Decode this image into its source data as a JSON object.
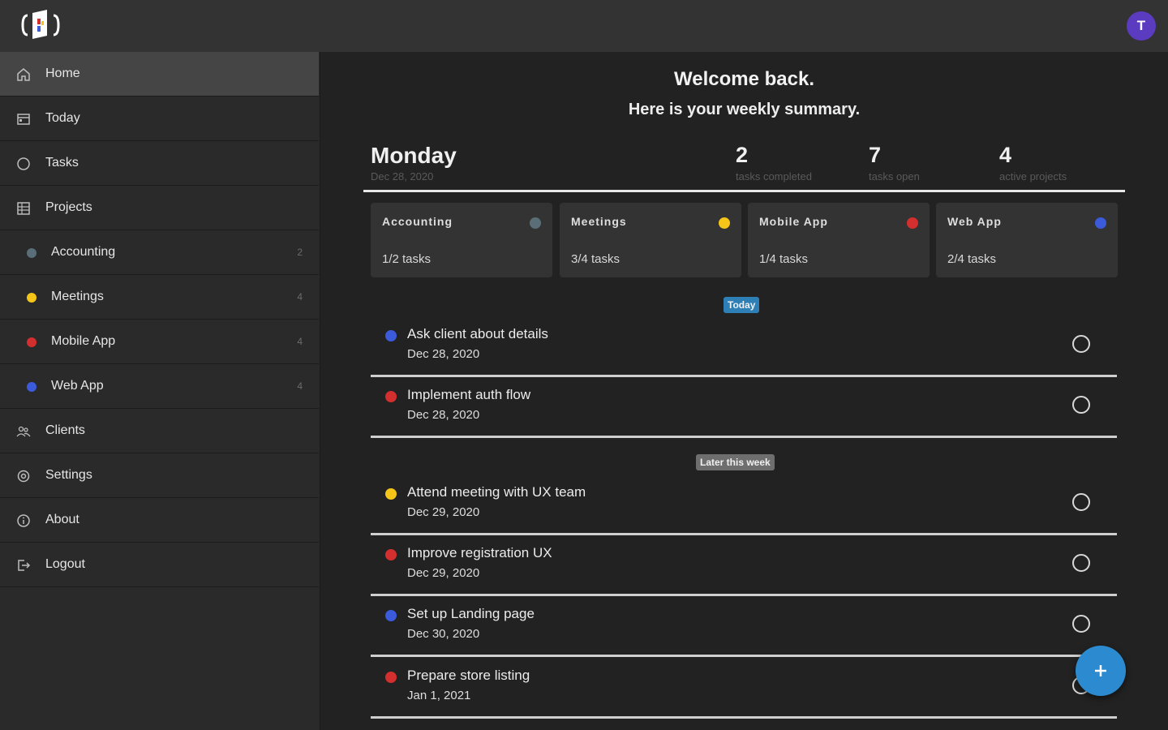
{
  "colors": {
    "accounting": "#5a6e78",
    "meetings": "#f5c518",
    "mobile_app": "#d32f2f",
    "web_app": "#3b5bdb",
    "accent": "#2c8bd0",
    "avatar": "#5b3bbf"
  },
  "header": {
    "avatar_initial": "T"
  },
  "sidebar": {
    "items": [
      {
        "label": "Home",
        "icon": "home-icon"
      },
      {
        "label": "Today",
        "icon": "calendar-icon"
      },
      {
        "label": "Tasks",
        "icon": "circle-icon"
      },
      {
        "label": "Projects",
        "icon": "grid-icon"
      },
      {
        "label": "Accounting",
        "count": "2"
      },
      {
        "label": "Meetings",
        "count": "4"
      },
      {
        "label": "Mobile App",
        "count": "4"
      },
      {
        "label": "Web App",
        "count": "4"
      },
      {
        "label": "Clients",
        "icon": "people-icon"
      },
      {
        "label": "Settings",
        "icon": "gear-icon"
      },
      {
        "label": "About",
        "icon": "info-icon"
      },
      {
        "label": "Logout",
        "icon": "logout-icon"
      }
    ]
  },
  "main": {
    "welcome": "Welcome back.",
    "summary": "Here is your weekly summary.",
    "day": "Monday",
    "date": "Dec 28, 2020",
    "stats": [
      {
        "value": "2",
        "label": "tasks completed"
      },
      {
        "value": "7",
        "label": "tasks open"
      },
      {
        "value": "4",
        "label": "active projects"
      }
    ],
    "projects": [
      {
        "name": "Accounting",
        "tasks": "1/2 tasks"
      },
      {
        "name": "Meetings",
        "tasks": "3/4 tasks"
      },
      {
        "name": "Mobile App",
        "tasks": "1/4 tasks"
      },
      {
        "name": "Web App",
        "tasks": "2/4 tasks"
      }
    ],
    "today_label": "Today",
    "later_label": "Later this week",
    "tasks": [
      {
        "title": "Ask client about details",
        "date": "Dec 28, 2020"
      },
      {
        "title": "Implement auth flow",
        "date": "Dec 28, 2020"
      },
      {
        "title": "Attend meeting with UX team",
        "date": "Dec 29, 2020"
      },
      {
        "title": "Improve registration UX",
        "date": "Dec 29, 2020"
      },
      {
        "title": "Set up Landing page",
        "date": "Dec 30, 2020"
      },
      {
        "title": "Prepare store listing",
        "date": "Jan 1, 2021"
      }
    ],
    "fab_icon": "plus-icon"
  }
}
